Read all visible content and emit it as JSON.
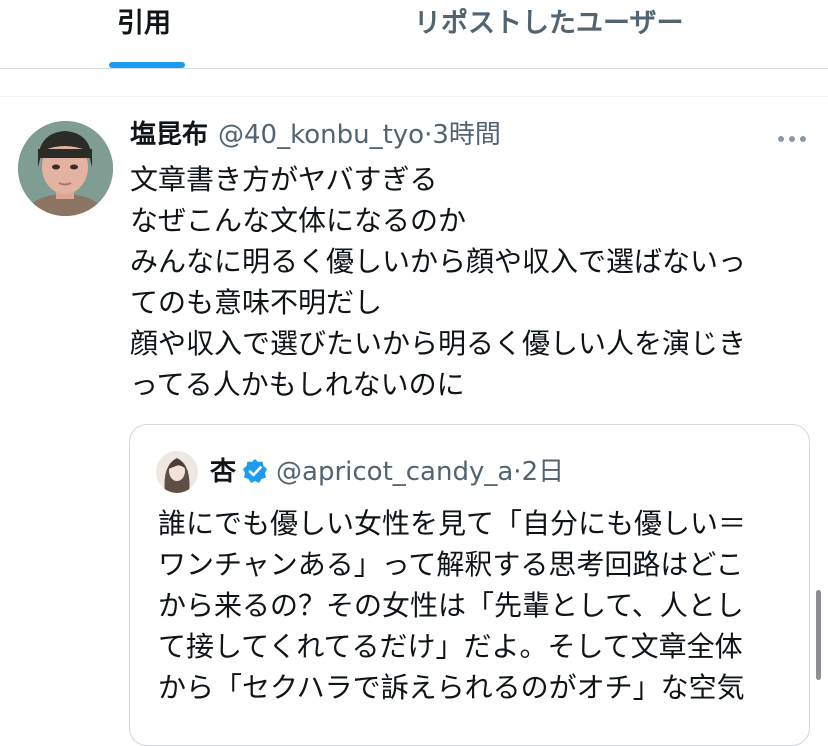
{
  "tabs": [
    {
      "label": "引用",
      "active": true
    },
    {
      "label": "リポストしたユーザー",
      "active": false
    }
  ],
  "colors": {
    "accent": "#1d9bf0",
    "secondary_text": "#536471",
    "divider": "#cfd9de"
  },
  "tweet": {
    "display_name": "塩昆布",
    "handle": "@40_konbu_tyo",
    "separator": "·",
    "time": "3時間",
    "avatar_icon": "user-avatar-icon",
    "more_icon": "more-horizontal-icon",
    "lines": [
      "文章書き方がヤバすぎる",
      "なぜこんな文体になるのか",
      "みんなに明るく優しいから顔や収入で選ばないっ",
      "てのも意味不明だし",
      "顔や収入で選びたいから明るく優しい人を演じき",
      "ってる人かもしれないのに"
    ]
  },
  "quoted_tweet": {
    "display_name": "杏",
    "verified_icon": "verified-badge-icon",
    "handle": "@apricot_candy_a",
    "separator": "·",
    "time": "2日",
    "lines": [
      "誰にでも優しい女性を見て「自分にも優しい＝",
      "ワンチャンある」って解釈する思考回路はどこ",
      "から来るの？その女性は「先輩として、人とし",
      "て接してくれてるだけ」だよ。そして文章全体",
      "から「セクハラで訴えられるのがオチ」な空気"
    ]
  }
}
